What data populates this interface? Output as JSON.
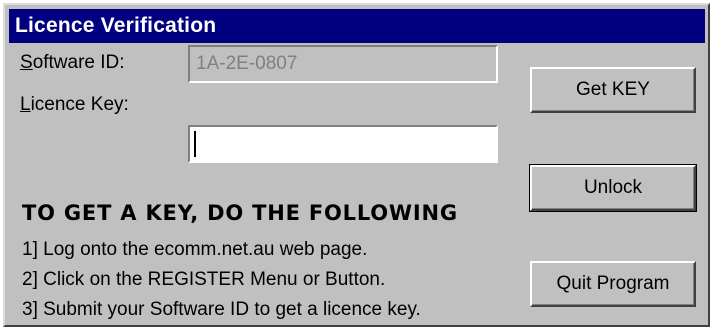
{
  "window": {
    "title": "Licence Verification"
  },
  "form": {
    "software_id": {
      "label_accel": "S",
      "label_rest": "oftware ID:",
      "value": "1A-2E-0807"
    },
    "licence_key": {
      "label_accel": "L",
      "label_rest": "icence Key:",
      "value": ""
    }
  },
  "buttons": {
    "get_key": "Get KEY",
    "unlock": "Unlock",
    "quit": "Quit Program"
  },
  "instructions": {
    "heading": "TO GET A KEY, DO THE FOLLOWING",
    "steps": [
      "1] Log onto the ecomm.net.au web page.",
      "2] Click on the REGISTER Menu or Button.",
      "3] Submit your Software ID to get a licence key."
    ]
  },
  "colors": {
    "titlebar": "#000080",
    "dialog_face": "#c0c0c0",
    "disabled_text": "#808080"
  }
}
